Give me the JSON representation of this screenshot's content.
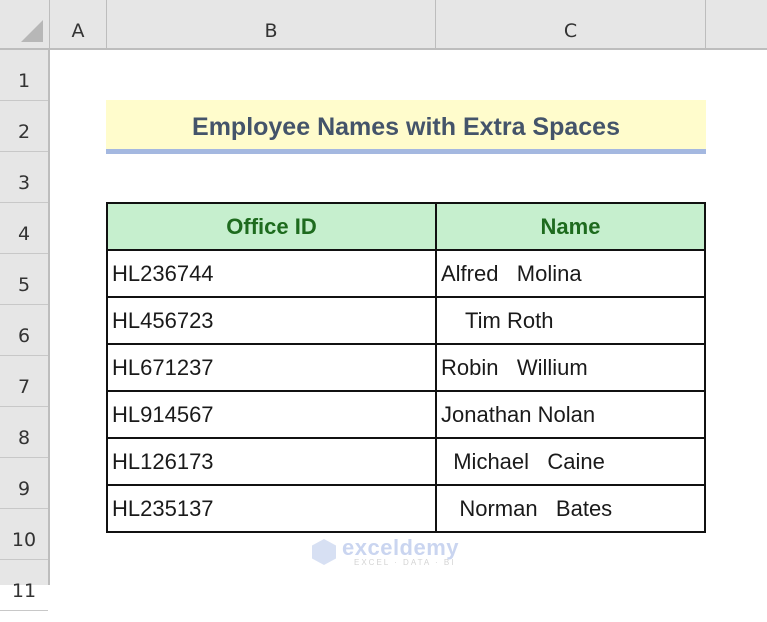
{
  "spreadsheet": {
    "columns": [
      "A",
      "B",
      "C"
    ],
    "rows": [
      "1",
      "2",
      "3",
      "4",
      "5",
      "6",
      "7",
      "8",
      "9",
      "10",
      "11"
    ]
  },
  "title": "Employee Names with Extra Spaces",
  "table": {
    "headers": [
      "Office ID",
      "Name"
    ],
    "rows": [
      {
        "id": "HL236744",
        "name": "Alfred   Molina"
      },
      {
        "id": "HL456723",
        "name": "    Tim Roth"
      },
      {
        "id": "HL671237",
        "name": "Robin   Willium"
      },
      {
        "id": "HL914567",
        "name": "Jonathan Nolan"
      },
      {
        "id": "HL126173",
        "name": "  Michael   Caine"
      },
      {
        "id": "HL235137",
        "name": "   Norman   Bates"
      }
    ]
  },
  "watermark": {
    "brand": "exceldemy",
    "tagline": "EXCEL · DATA · BI"
  },
  "colors": {
    "title_bg": "#fffccc",
    "title_border": "#a4b8e0",
    "header_bg": "#c6efce",
    "header_text": "#1e6b1e"
  }
}
